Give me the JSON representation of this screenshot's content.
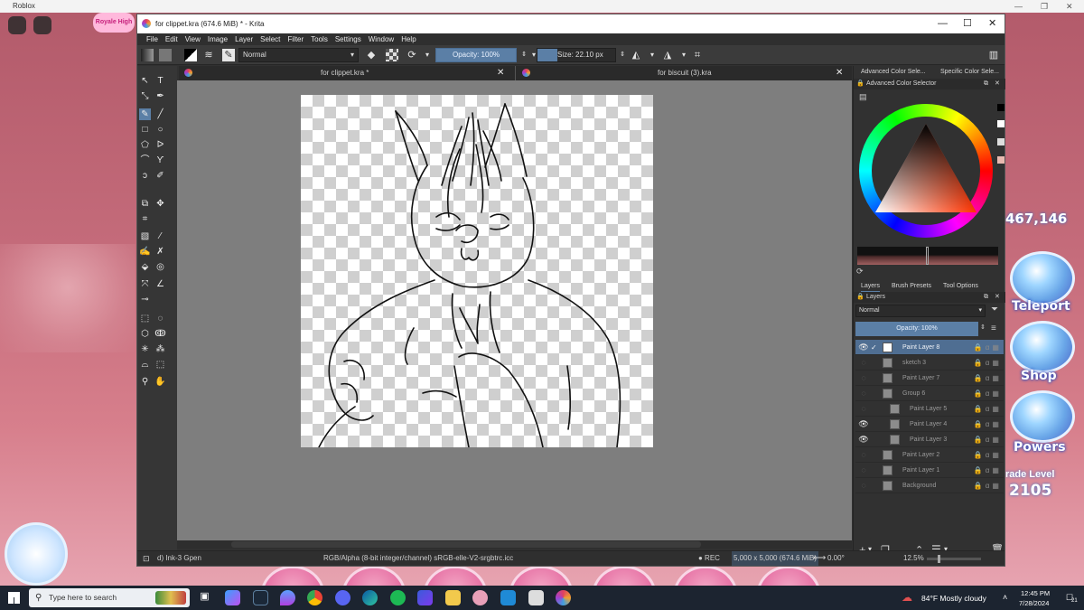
{
  "roblox": {
    "window_title": "Roblox",
    "logo_text": "Royale High",
    "currency": "467,146",
    "side_buttons": [
      "Teleport",
      "Shop",
      "Powers"
    ],
    "grade_label": "rade Level",
    "grade_value": "2105"
  },
  "krita": {
    "title": "for clippet.kra (674.6 MiB)  * - Krita",
    "menu": [
      "File",
      "Edit",
      "View",
      "Image",
      "Layer",
      "Select",
      "Filter",
      "Tools",
      "Settings",
      "Window",
      "Help"
    ],
    "toolbar": {
      "blend_mode": "Normal",
      "opacity": "Opacity: 100%",
      "size": "Size: 22.10 px"
    },
    "tabs": [
      {
        "label": "for clippet.kra *",
        "active": true
      },
      {
        "label": "for biscuit (3).kra",
        "active": false
      }
    ],
    "status": {
      "brush": "d) Ink-3 Gpen",
      "color_space": "RGB/Alpha (8-bit integer/channel)  sRGB-elle-V2-srgbtrc.icc",
      "rec": "● REC",
      "dimensions": "5,000 x 5,000 (674.6 MiB)",
      "rotation": "0.00°",
      "zoom": "12.5%"
    },
    "color_docker": {
      "tabs": [
        "Advanced Color Sele...",
        "Specific Color Sele..."
      ],
      "title": "Advanced Color Selector"
    },
    "layer_docker": {
      "tabs": [
        "Layers",
        "Brush Presets",
        "Tool Options"
      ],
      "title": "Layers",
      "blend_mode": "Normal",
      "opacity": "Opacity:  100%",
      "layers": [
        {
          "name": "Paint Layer 8",
          "visible": true,
          "active": true,
          "indent": 0
        },
        {
          "name": "sketch 3",
          "visible": false,
          "active": false,
          "indent": 0
        },
        {
          "name": "Paint Layer 7",
          "visible": false,
          "active": false,
          "indent": 0
        },
        {
          "name": "Group 6",
          "visible": false,
          "active": false,
          "indent": 0
        },
        {
          "name": "Paint Layer 5",
          "visible": false,
          "active": false,
          "indent": 1
        },
        {
          "name": "Paint Layer 4",
          "visible": true,
          "active": false,
          "indent": 1
        },
        {
          "name": "Paint Layer 3",
          "visible": true,
          "active": false,
          "indent": 1
        },
        {
          "name": "Paint Layer 2",
          "visible": false,
          "active": false,
          "indent": 0
        },
        {
          "name": "Paint Layer 1",
          "visible": false,
          "active": false,
          "indent": 0
        },
        {
          "name": "Background",
          "visible": false,
          "active": false,
          "indent": 0
        }
      ]
    }
  },
  "taskbar": {
    "search_placeholder": "Type here to search",
    "weather": "84°F  Mostly cloudy",
    "time": "12:45 PM",
    "date": "7/28/2024",
    "notifications": "21"
  },
  "colors": {
    "accent": "#5b7fa6",
    "active_layer": "#4f6e92",
    "krita_bg": "#313131"
  }
}
